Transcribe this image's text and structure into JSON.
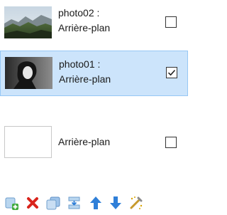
{
  "layers": [
    {
      "title_line1": "photo02 :",
      "title_line2": "Arrière-plan",
      "checked": false,
      "selected": false,
      "thumbnail": "mountain-landscape"
    },
    {
      "title_line1": "photo01 :",
      "title_line2": "Arrière-plan",
      "checked": true,
      "selected": true,
      "thumbnail": "woman-portrait-bw"
    },
    {
      "title_line1": "",
      "title_line2": "Arrière-plan",
      "checked": false,
      "selected": false,
      "thumbnail": "blank"
    }
  ],
  "toolbar": {
    "buttons": [
      {
        "icon": "new-layer-icon"
      },
      {
        "icon": "delete-icon"
      },
      {
        "icon": "duplicate-icon"
      },
      {
        "icon": "merge-down-icon"
      },
      {
        "icon": "move-up-icon"
      },
      {
        "icon": "move-down-icon"
      },
      {
        "icon": "properties-icon"
      }
    ]
  },
  "colors": {
    "selection_bg": "#cce4fb",
    "selection_border": "#96c7f5",
    "delete_red": "#d9241c",
    "arrow_blue": "#2f7fd8"
  }
}
